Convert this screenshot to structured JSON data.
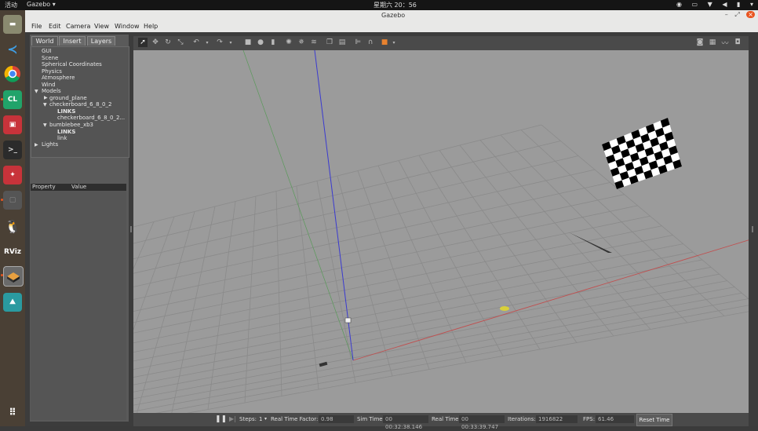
{
  "topbar": {
    "activities": "活动",
    "app_name": "Gazebo ▾",
    "clock": "星期六 20：56"
  },
  "window": {
    "title": "Gazebo",
    "close_glyph": "×"
  },
  "menubar": {
    "items": [
      "File",
      "Edit",
      "Camera",
      "View",
      "Window",
      "Help"
    ]
  },
  "left_panel": {
    "tabs": [
      "World",
      "Insert",
      "Layers"
    ],
    "tree": {
      "gui": "GUI",
      "scene": "Scene",
      "spherical": "Spherical Coordinates",
      "physics": "Physics",
      "atmosphere": "Atmosphere",
      "wind": "Wind",
      "models": "Models",
      "ground_plane": "ground_plane",
      "checkerboard": "checkerboard_6_8_0_2",
      "checkerboard_links": "LINKS",
      "checkerboard_link": "checkerboard_6_8_0_2...",
      "bumblebee": "bumblebee_xb3",
      "bumblebee_links": "LINKS",
      "bumblebee_link": "link",
      "lights": "Lights"
    },
    "property_header": {
      "property": "Property",
      "value": "Value"
    }
  },
  "dock": {
    "icons": [
      "files-icon",
      "vscode-icon",
      "chrome-icon",
      "clion-icon",
      "app-icon",
      "terminal-icon",
      "app2-icon",
      "app3-icon",
      "qq-icon",
      "rviz-icon",
      "gazebo-icon",
      "image-viewer-icon",
      "apps-grid-icon"
    ],
    "labels": {
      "clion": "CL",
      "rviz": "RViz"
    }
  },
  "bottom_bar": {
    "steps_label": "Steps:",
    "steps_value": "1",
    "rtf_label": "Real Time Factor:",
    "rtf_value": "0.98",
    "sim_time_label": "Sim Time:",
    "sim_time_value": "00 00:32:38.146",
    "real_time_label": "Real Time:",
    "real_time_value": "00 00:33:39.747",
    "iterations_label": "Iterations:",
    "iterations_value": "1916822",
    "fps_label": "FPS:",
    "fps_value": "61.46",
    "reset_label": "Reset Time"
  },
  "colors": {
    "viewport_bg": "#9b9b9b",
    "grid_line": "#8a8a8a",
    "x_axis": "#c05050",
    "y_axis": "#5a9a5a",
    "z_axis": "#3a3ad0",
    "panel_bg": "#5a5a5a"
  }
}
